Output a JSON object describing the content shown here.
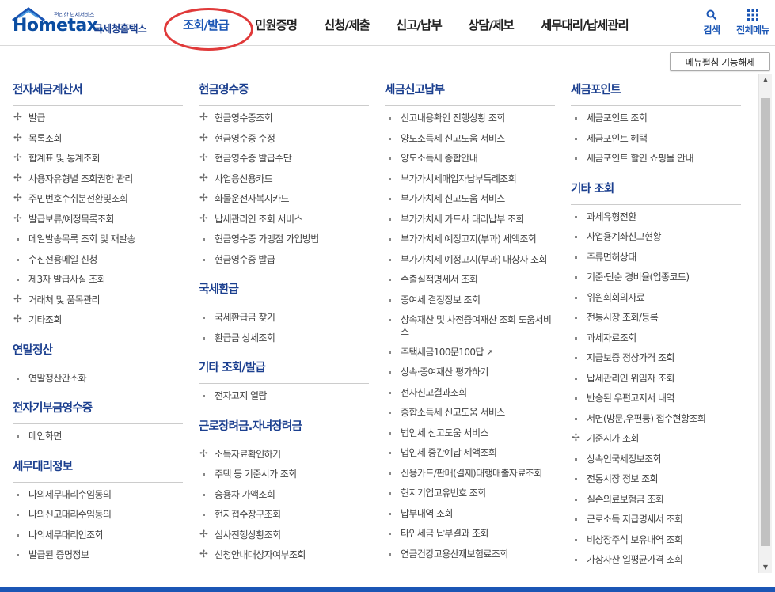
{
  "logo": {
    "tagline": "편리한 납세서비스",
    "word": "Hometax.",
    "kr_name": "국세청홈택스"
  },
  "nav": [
    "조회/발급",
    "민원증명",
    "신청/제출",
    "신고/납부",
    "상담/제보",
    "세무대리/납세관리"
  ],
  "header_buttons": {
    "search": "검색",
    "all_menu": "전체메뉴"
  },
  "menu_toggle": "메뉴펼침 기능해제",
  "columns": [
    [
      {
        "title": "전자세금계산서",
        "items": [
          {
            "t": "발급",
            "m": "plus"
          },
          {
            "t": "목록조회",
            "m": "plus"
          },
          {
            "t": "합계표 및 통계조회",
            "m": "plus"
          },
          {
            "t": "사용자유형별 조회권한 관리",
            "m": "plus"
          },
          {
            "t": "주민번호수취분전환및조회",
            "m": "plus"
          },
          {
            "t": "발급보류/예정목록조회",
            "m": "plus"
          },
          {
            "t": "메일발송목록 조회 및 재발송",
            "m": "dot"
          },
          {
            "t": "수신전용메일 신청",
            "m": "dot"
          },
          {
            "t": "제3자 발급사실 조회",
            "m": "dot"
          },
          {
            "t": "거래처 및 품목관리",
            "m": "plus"
          },
          {
            "t": "기타조회",
            "m": "plus"
          }
        ]
      },
      {
        "title": "연말정산",
        "items": [
          {
            "t": "연말정산간소화",
            "m": "dot"
          }
        ]
      },
      {
        "title": "전자기부금영수증",
        "items": [
          {
            "t": "메인화면",
            "m": "dot"
          }
        ]
      },
      {
        "title": "세무대리정보",
        "items": [
          {
            "t": "나의세무대리수임동의",
            "m": "dot"
          },
          {
            "t": "나의신고대리수임동의",
            "m": "dot"
          },
          {
            "t": "나의세무대리인조회",
            "m": "dot"
          },
          {
            "t": "발급된 증명정보",
            "m": "dot"
          }
        ]
      }
    ],
    [
      {
        "title": "현금영수증",
        "items": [
          {
            "t": "현금영수증조회",
            "m": "plus"
          },
          {
            "t": "현금영수증 수정",
            "m": "plus"
          },
          {
            "t": "현금영수증 발급수단",
            "m": "plus"
          },
          {
            "t": "사업용신용카드",
            "m": "plus"
          },
          {
            "t": "화물운전자복지카드",
            "m": "plus"
          },
          {
            "t": "납세관리인 조회 서비스",
            "m": "plus"
          },
          {
            "t": "현금영수증 가맹점 가입방법",
            "m": "dot"
          },
          {
            "t": "현금영수증 발급",
            "m": "dot"
          }
        ]
      },
      {
        "title": "국세환급",
        "items": [
          {
            "t": "국세환급금 찾기",
            "m": "dot"
          },
          {
            "t": "환급금 상세조회",
            "m": "dot"
          }
        ]
      },
      {
        "title": "기타 조회/발급",
        "items": [
          {
            "t": "전자고지 열람",
            "m": "dot"
          }
        ]
      },
      {
        "title": "근로장려금.자녀장려금",
        "items": [
          {
            "t": "소득자료확인하기",
            "m": "plus"
          },
          {
            "t": "주택 등 기준시가 조회",
            "m": "dot"
          },
          {
            "t": "승용차 가액조회",
            "m": "dot"
          },
          {
            "t": "현지접수장구조회",
            "m": "dot"
          },
          {
            "t": "심사진행상황조회",
            "m": "plus"
          },
          {
            "t": "신청안내대상자여부조회",
            "m": "plus"
          }
        ]
      }
    ],
    [
      {
        "title": "세금신고납부",
        "items": [
          {
            "t": "신고내용확인 진행상황 조회",
            "m": "dot"
          },
          {
            "t": "양도소득세 신고도움 서비스",
            "m": "dot"
          },
          {
            "t": "양도소득세 종합안내",
            "m": "dot"
          },
          {
            "t": "부가가치세매입자납부특례조회",
            "m": "dot"
          },
          {
            "t": "부가가치세 신고도움 서비스",
            "m": "dot"
          },
          {
            "t": "부가가치세 카드사 대리납부 조회",
            "m": "dot"
          },
          {
            "t": "부가가치세 예정고지(부과) 세액조회",
            "m": "dot"
          },
          {
            "t": "부가가치세 예정고지(부과) 대상자 조회",
            "m": "dot"
          },
          {
            "t": "수출실적명세서 조회",
            "m": "dot"
          },
          {
            "t": "증여세 결정정보 조회",
            "m": "dot"
          },
          {
            "t": "상속재산 및 사전증여재산 조회 도움서비스",
            "m": "dot"
          },
          {
            "t": "주택세금100문100답",
            "m": "dot",
            "ext": true
          },
          {
            "t": "상속·증여재산 평가하기",
            "m": "dot"
          },
          {
            "t": "전자신고결과조회",
            "m": "dot"
          },
          {
            "t": "종합소득세 신고도움 서비스",
            "m": "dot"
          },
          {
            "t": "법인세 신고도움 서비스",
            "m": "dot"
          },
          {
            "t": "법인세 중간예납 세액조회",
            "m": "dot"
          },
          {
            "t": "신용카드/판매(결제)대행매출자료조회",
            "m": "dot"
          },
          {
            "t": "현지기업고유번호 조회",
            "m": "dot"
          },
          {
            "t": "납부내역 조회",
            "m": "dot"
          },
          {
            "t": "타인세금 납부결과 조회",
            "m": "dot"
          },
          {
            "t": "연금건강고용산재보험료조회",
            "m": "dot"
          }
        ]
      }
    ],
    [
      {
        "title": "세금포인트",
        "items": [
          {
            "t": "세금포인트 조회",
            "m": "dot"
          },
          {
            "t": "세금포인트 혜택",
            "m": "dot"
          },
          {
            "t": "세금포인트 할인 쇼핑몰 안내",
            "m": "dot"
          }
        ]
      },
      {
        "title": "기타 조회",
        "items": [
          {
            "t": "과세유형전환",
            "m": "dot"
          },
          {
            "t": "사업용계좌신고현황",
            "m": "dot"
          },
          {
            "t": "주류면허상태",
            "m": "dot"
          },
          {
            "t": "기준·단순 경비율(업종코드)",
            "m": "dot"
          },
          {
            "t": "위원회회의자료",
            "m": "dot"
          },
          {
            "t": "전통시장 조회/등록",
            "m": "dot"
          },
          {
            "t": "과세자료조회",
            "m": "dot"
          },
          {
            "t": "지급보증 정상가격 조회",
            "m": "dot"
          },
          {
            "t": "납세관리인 위임자 조회",
            "m": "dot"
          },
          {
            "t": "반송된 우편고지서 내역",
            "m": "dot"
          },
          {
            "t": "서면(방문,우편등) 접수현황조회",
            "m": "dot"
          },
          {
            "t": "기준시가 조회",
            "m": "plus"
          },
          {
            "t": "상속인국세정보조회",
            "m": "dot"
          },
          {
            "t": "전통시장 정보 조회",
            "m": "dot"
          },
          {
            "t": "실손의료보험금 조회",
            "m": "dot"
          },
          {
            "t": "근로소득 지급명세서 조회",
            "m": "dot"
          },
          {
            "t": "비상장주식 보유내역 조회",
            "m": "dot"
          },
          {
            "t": "가상자산 일평균가격 조회",
            "m": "dot"
          }
        ]
      }
    ]
  ]
}
